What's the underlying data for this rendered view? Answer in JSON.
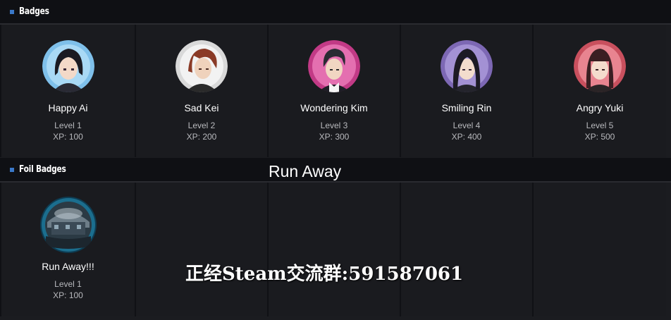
{
  "sections": {
    "badges_title": "Badges",
    "foil_title": "Foil Badges"
  },
  "badges": [
    {
      "name": "Happy Ai",
      "level": "Level 1",
      "xp": "XP: 100",
      "ring_color": "#7fc0ea"
    },
    {
      "name": "Sad Kei",
      "level": "Level 2",
      "xp": "XP: 200",
      "ring_color": "#e8e8e8"
    },
    {
      "name": "Wondering Kim",
      "level": "Level 3",
      "xp": "XP: 300",
      "ring_color": "#d9509e"
    },
    {
      "name": "Smiling Rin",
      "level": "Level 4",
      "xp": "XP: 400",
      "ring_color": "#8e78c2"
    },
    {
      "name": "Angry Yuki",
      "level": "Level 5",
      "xp": "XP: 500",
      "ring_color": "#d86470"
    }
  ],
  "foil_badges": [
    {
      "name": "Run Away!!!",
      "level": "Level 1",
      "xp": "XP: 100",
      "ring_color": "#2a8fb0"
    }
  ],
  "overlay_title": "Run Away",
  "watermark": "正经Steam交流群:591587061"
}
